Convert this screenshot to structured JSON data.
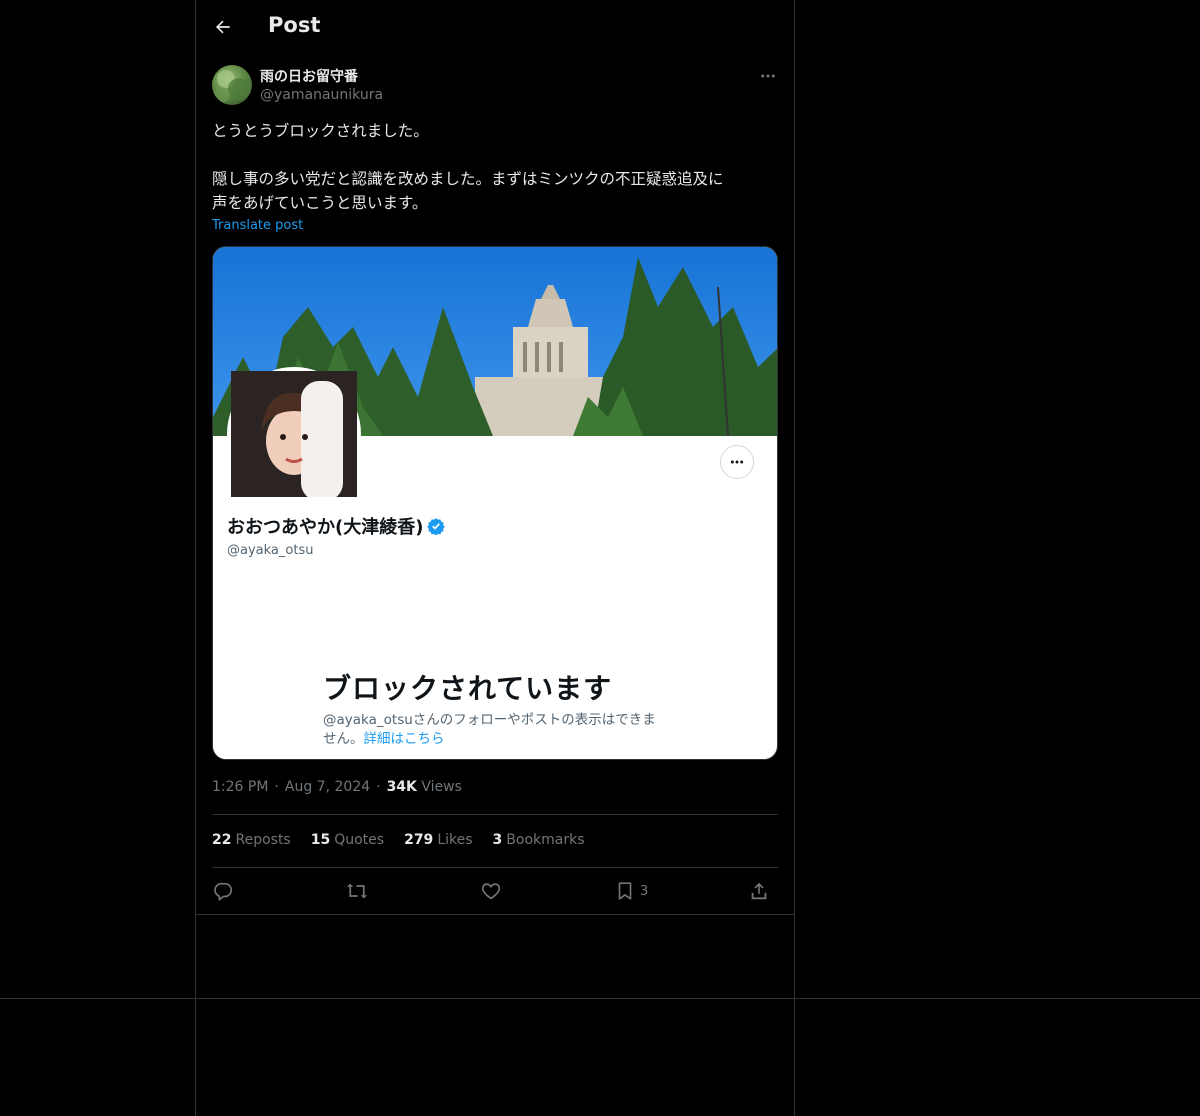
{
  "header": {
    "title": "Post"
  },
  "author": {
    "display_name": "雨の日お留守番",
    "handle": "@yamanaunikura"
  },
  "post": {
    "lines": [
      "とうとうブロックされました。",
      "",
      "隠し事の多い党だと認識を改めました。まずはミンツクの不正疑惑追及に",
      "声をあげていこうと思います。"
    ],
    "translate_label": "Translate post"
  },
  "media_card": {
    "name": "おおつあやか(大津綾香)",
    "handle": "@ayaka_otsu",
    "blocked_title": "ブロックされています",
    "blocked_desc": "@ayaka_otsuさんのフォローやポストの表示はできません。",
    "blocked_link": "詳細はこちら"
  },
  "meta": {
    "time": "1:26 PM",
    "date": "Aug 7, 2024",
    "views_count": "34K",
    "views_label": "Views"
  },
  "stats": [
    {
      "count": "22",
      "label": "Reposts"
    },
    {
      "count": "15",
      "label": "Quotes"
    },
    {
      "count": "279",
      "label": "Likes"
    },
    {
      "count": "3",
      "label": "Bookmarks"
    }
  ],
  "actions": {
    "reply_icon": "reply-icon",
    "repost_icon": "repost-icon",
    "like_icon": "heart-icon",
    "bookmark_icon": "bookmark-icon",
    "bookmark_count": "3",
    "share_icon": "share-icon"
  },
  "colors": {
    "background": "#000000",
    "accent": "#1d9bf0",
    "border": "#2f3336",
    "muted": "#71767b"
  }
}
